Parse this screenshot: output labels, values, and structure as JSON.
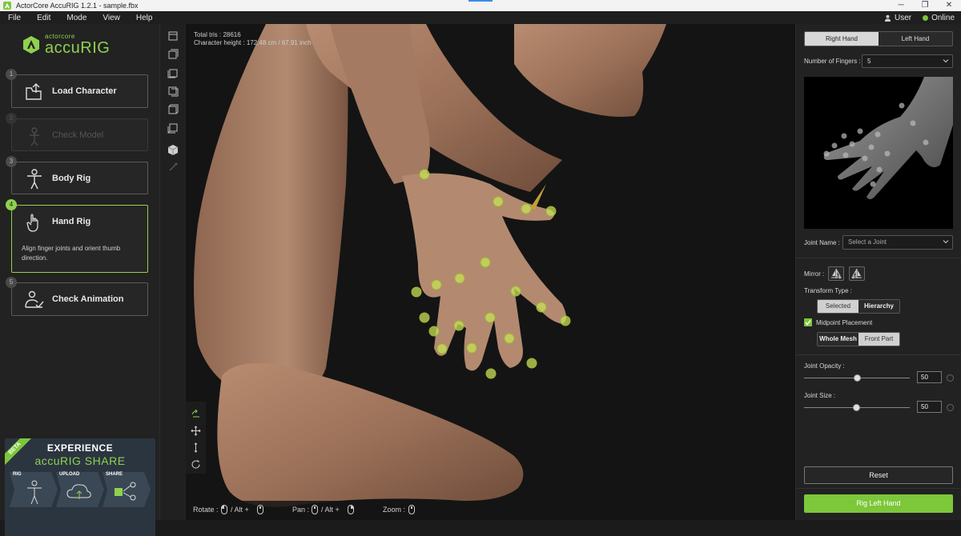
{
  "window": {
    "title": "ActorCore AccuRIG 1.2.1 - sample.fbx",
    "controls": [
      "─",
      "❐",
      "✕"
    ]
  },
  "menu": {
    "items": [
      "File",
      "Edit",
      "Mode",
      "View",
      "Help"
    ],
    "user": "User",
    "status": "Online"
  },
  "logo": {
    "brand": "actorcore",
    "product": "accuRIG"
  },
  "steps": [
    {
      "num": "1",
      "label": "Load Character",
      "state": "done"
    },
    {
      "num": "2",
      "label": "Check Model",
      "state": "disabled"
    },
    {
      "num": "3",
      "label": "Body Rig",
      "state": "done"
    },
    {
      "num": "4",
      "label": "Hand Rig",
      "state": "active",
      "desc": "Align finger joints and orient thumb direction."
    },
    {
      "num": "5",
      "label": "Check Animation",
      "state": "done"
    }
  ],
  "banner": {
    "badge": "BETA",
    "line1": "EXPERIENCE",
    "line2": "accuRIG SHARE",
    "stages": [
      "RIG",
      "UPLOAD",
      "SHARE"
    ]
  },
  "viewport": {
    "total_tris": "Total tris : 28616",
    "char_height": "Character height : 172.48 cm / 67.91 inch",
    "help": {
      "rotate": "Rotate :",
      "rotate_alt": "/ Alt +",
      "pan": "Pan :",
      "pan_alt": "/ Alt +",
      "zoom": "Zoom :"
    }
  },
  "right": {
    "hand_tabs": [
      "Right Hand",
      "Left Hand"
    ],
    "fingers_label": "Number of Fingers :",
    "fingers_value": "5",
    "joint_label": "Joint Name :",
    "joint_placeholder": "Select a Joint",
    "mirror_label": "Mirror :",
    "transform_label": "Transform Type :",
    "transform_options": [
      "Selected",
      "Hierarchy"
    ],
    "midpoint_label": "Midpoint Placement",
    "mesh_options": [
      "Whole Mesh",
      "Front Part"
    ],
    "opacity_label": "Joint Opacity :",
    "opacity_value": "50",
    "size_label": "Joint Size :",
    "size_value": "50",
    "reset": "Reset",
    "rig_button": "Rig Left Hand"
  },
  "colors": {
    "accent": "#7cc73a",
    "joint": "#c8e05a",
    "panel": "#222222"
  }
}
